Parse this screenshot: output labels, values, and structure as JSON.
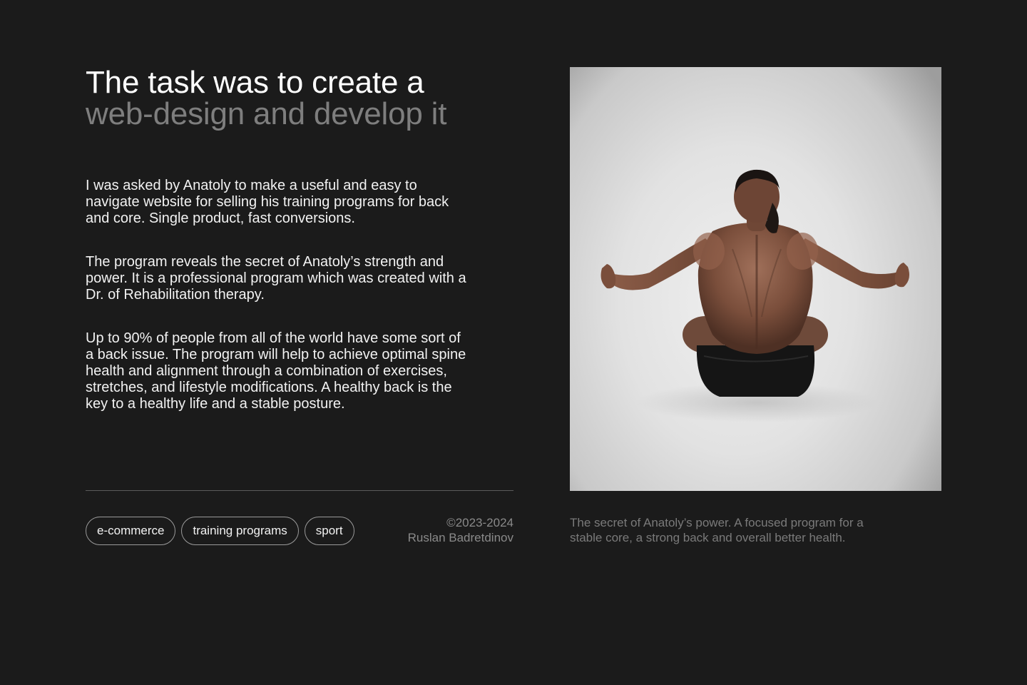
{
  "heading": {
    "line1": "The task was to create a",
    "line2": "web-design and develop it"
  },
  "paragraphs": [
    "I was asked by Anatoly to make a useful and easy to navigate website for selling his training programs for back and core. Single product, fast conversions.",
    "The program reveals the secret of Anatoly’s strength and power. It is a professional program which was created with a Dr. of Rehabilitation therapy.",
    "Up to 90% of people from all of the world have some sort of a back issue. The program will help to achieve optimal spine health and alignment through a combination of exercises, stretches, and lifestyle modifications. A healthy back is the key to a healthy life and a stable posture."
  ],
  "tags": [
    "e-commerce",
    "training programs",
    "sport"
  ],
  "credits": {
    "years": "©2023-2024",
    "author": "Ruslan Badretdinov"
  },
  "caption": "The secret of Anatoly’s power. A focused program for a stable core, a strong back and overall better health.",
  "colors": {
    "background": "#1b1b1b",
    "heading_primary": "#ffffff",
    "heading_secondary": "#7e7e7e",
    "muted_text": "#8a8a8a"
  }
}
